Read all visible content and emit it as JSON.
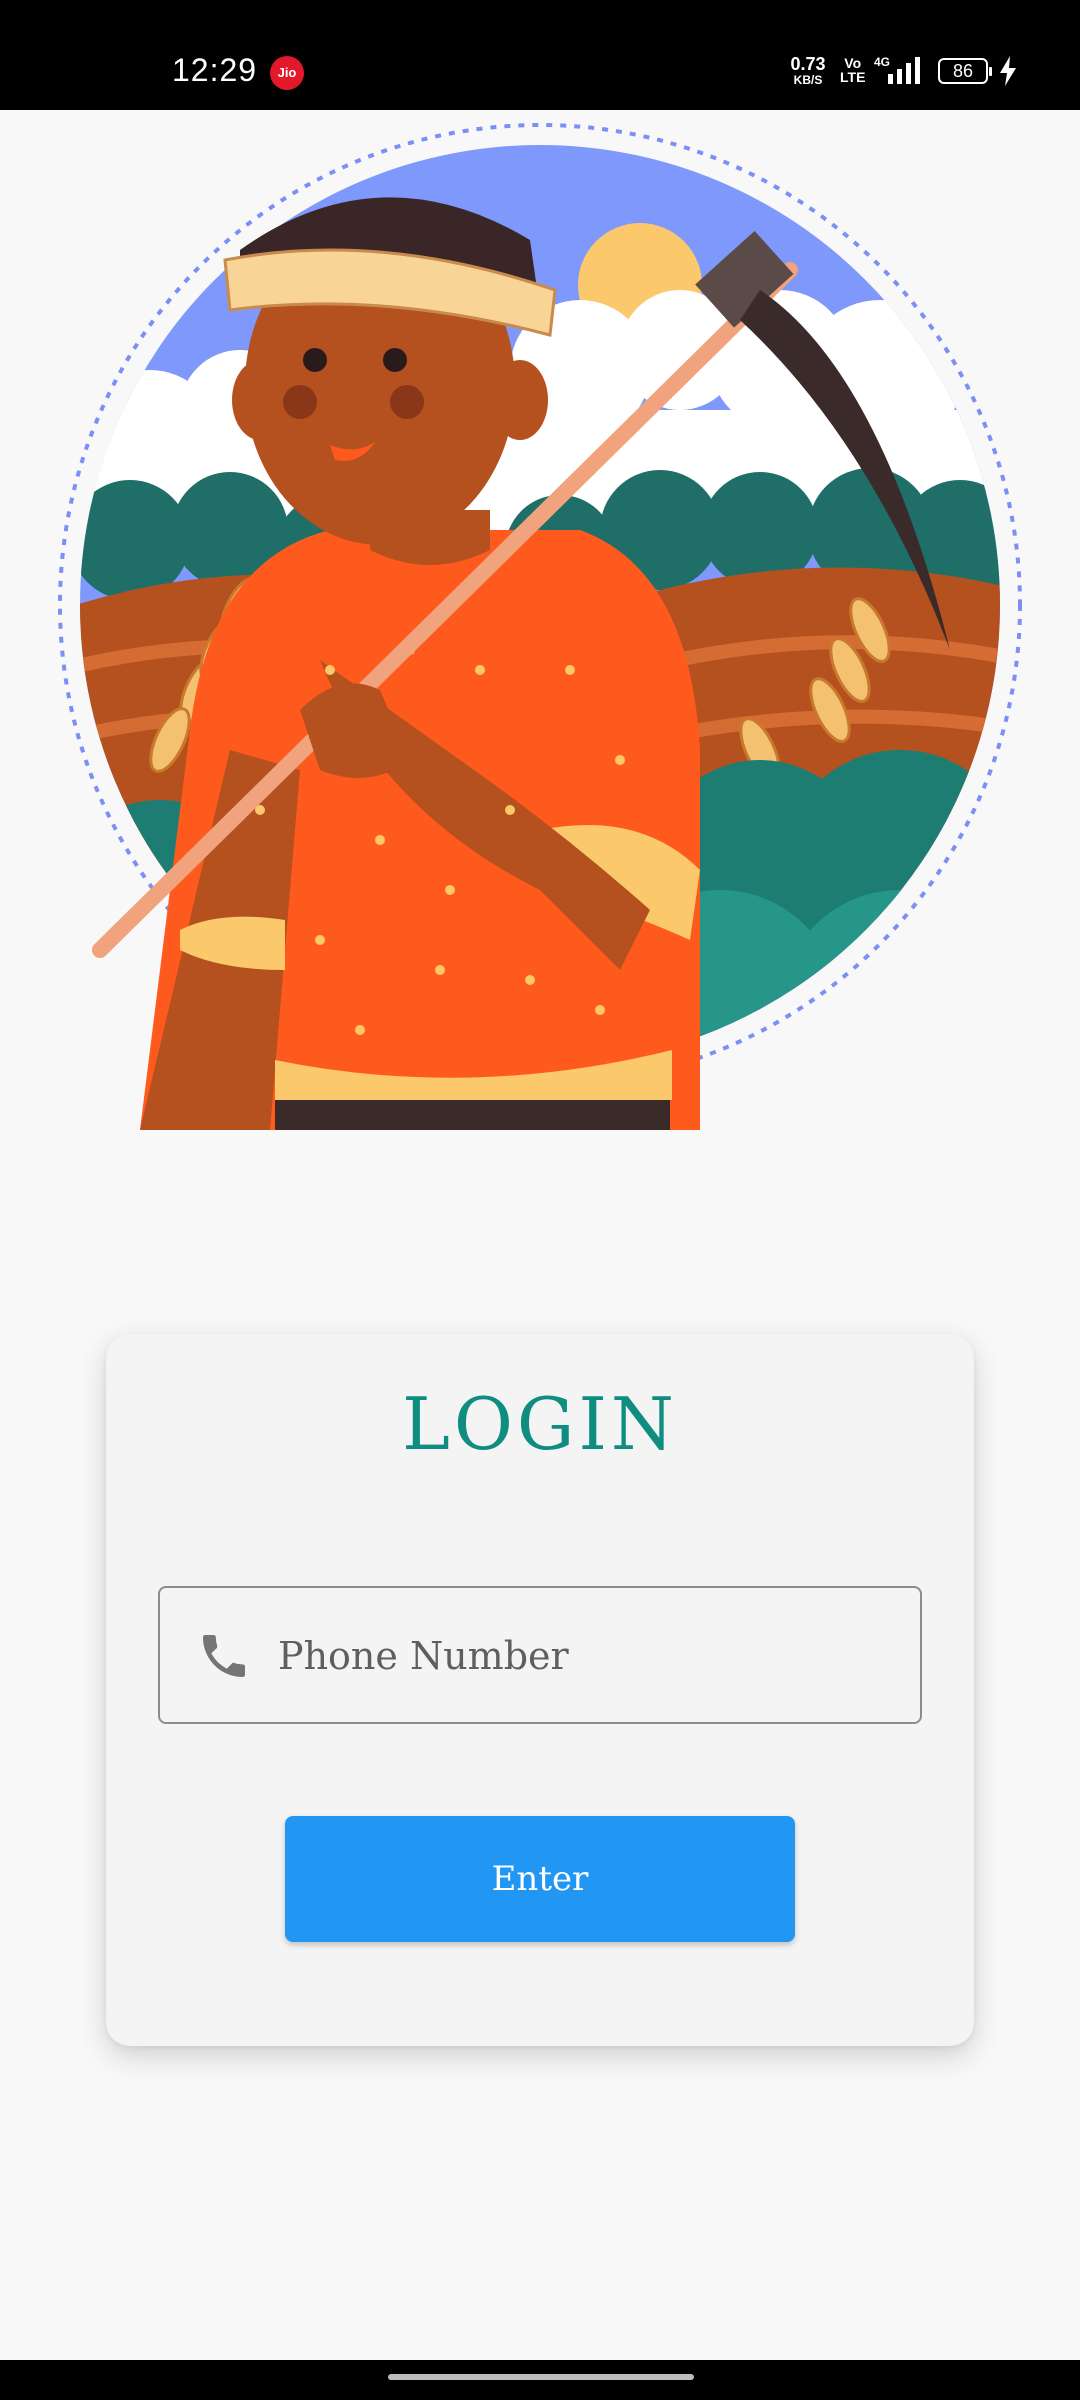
{
  "status_bar": {
    "time": "12:29",
    "carrier_badge": "Jio",
    "net_speed_value": "0.73",
    "net_speed_unit": "KB/S",
    "volte_top": "Vo",
    "volte_bottom": "LTE",
    "network_type": "4G",
    "battery_level": "86"
  },
  "hero": {
    "illustration": "farmer-with-scythe"
  },
  "login": {
    "title": "LOGIN",
    "phone_placeholder": "Phone Number",
    "phone_icon": "phone-icon",
    "enter_label": "Enter"
  },
  "colors": {
    "title": "#0e8d80",
    "button": "#2196f3",
    "background": "#f8f8f8"
  }
}
